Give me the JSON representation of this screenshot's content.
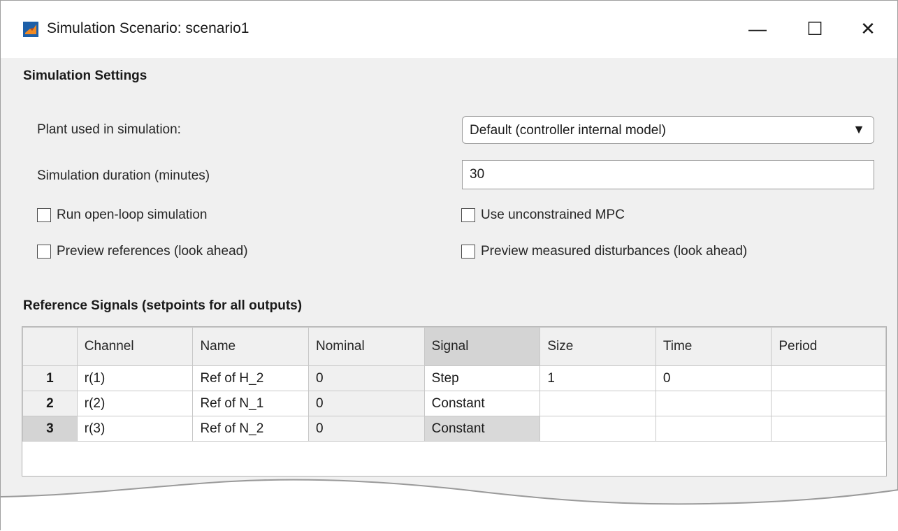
{
  "window": {
    "title": "Simulation Scenario: scenario1",
    "buttons": {
      "minimize": "—",
      "maximize": "☐",
      "close": "✕"
    }
  },
  "settings": {
    "heading": "Simulation Settings",
    "plant_label": "Plant used in simulation:",
    "plant_value": "Default (controller internal model)",
    "duration_label": "Simulation duration (minutes)",
    "duration_value": "30",
    "checkboxes": [
      {
        "label": "Run open-loop simulation",
        "checked": false
      },
      {
        "label": "Use unconstrained MPC",
        "checked": false
      },
      {
        "label": "Preview references (look ahead)",
        "checked": false
      },
      {
        "label": "Preview measured disturbances (look ahead)",
        "checked": false
      }
    ]
  },
  "reference": {
    "heading": "Reference Signals (setpoints for all outputs)",
    "columns": [
      "",
      "Channel",
      "Name",
      "Nominal",
      "Signal",
      "Size",
      "Time",
      "Period"
    ],
    "rows": [
      {
        "num": "1",
        "channel": "r(1)",
        "name": "Ref of H_2",
        "nominal": "0",
        "signal": "Step",
        "size": "1",
        "time": "0",
        "period": ""
      },
      {
        "num": "2",
        "channel": "r(2)",
        "name": "Ref of N_1",
        "nominal": "0",
        "signal": "Constant",
        "size": "",
        "time": "",
        "period": ""
      },
      {
        "num": "3",
        "channel": "r(3)",
        "name": "Ref of N_2",
        "nominal": "0",
        "signal": "Constant",
        "size": "",
        "time": "",
        "period": ""
      }
    ]
  },
  "colors": {
    "window_bg": "#f0f0f0",
    "selected": "#d4d4d4"
  }
}
